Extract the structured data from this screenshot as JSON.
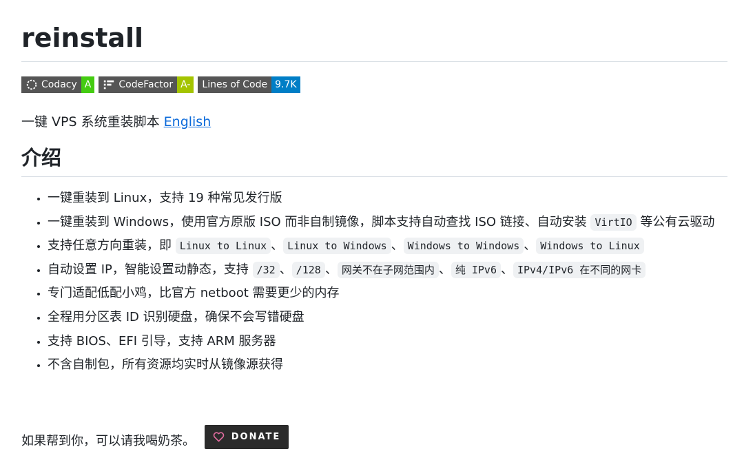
{
  "title": "reinstall",
  "badges": [
    {
      "icon": "codacy-icon",
      "label": "Codacy",
      "value": "A",
      "color": "#44cc11"
    },
    {
      "icon": "codefactor-icon",
      "label": "CodeFactor",
      "value": "A-",
      "color": "#a4c400"
    },
    {
      "label": "Lines of Code",
      "value": "9.7K",
      "color": "#007ec6"
    }
  ],
  "tagline": {
    "text": "一键 VPS 系统重装脚本 ",
    "link": "English"
  },
  "section_title": "介绍",
  "features": {
    "f1": "一键重装到 Linux，支持 19 种常见发行版",
    "f2_a": "一键重装到 Windows，使用官方原版 ISO 而非自制镜像，脚本支持自动查找 ISO 链接、自动安装 ",
    "f2_code": "VirtIO",
    "f2_b": " 等公有云驱动",
    "f3_a": "支持任意方向重装，即 ",
    "f3_c1": "Linux to Linux",
    "f3_c2": "Linux to Windows",
    "f3_c3": "Windows to Windows",
    "f3_c4": "Windows to Linux",
    "f4_a": "自动设置 IP，智能设置动静态，支持 ",
    "f4_c1": "/32",
    "f4_c2": "/128",
    "f4_c3": "网关不在子网范围内",
    "f4_c4": "纯 IPv6",
    "f4_c5": "IPv4/IPv6 在不同的网卡",
    "f5": "专门适配低配小鸡，比官方 netboot 需要更少的内存",
    "f6": "全程用分区表 ID 识别硬盘，确保不会写错硬盘",
    "f7": "支持 BIOS、EFI 引导，支持 ARM 服务器",
    "f8": "不含自制包，所有资源均实时从镜像源获得"
  },
  "separator": "、",
  "donate": {
    "text": "如果帮到你，可以请我喝奶茶。",
    "button": "DONATE",
    "icon": "heart-icon"
  }
}
